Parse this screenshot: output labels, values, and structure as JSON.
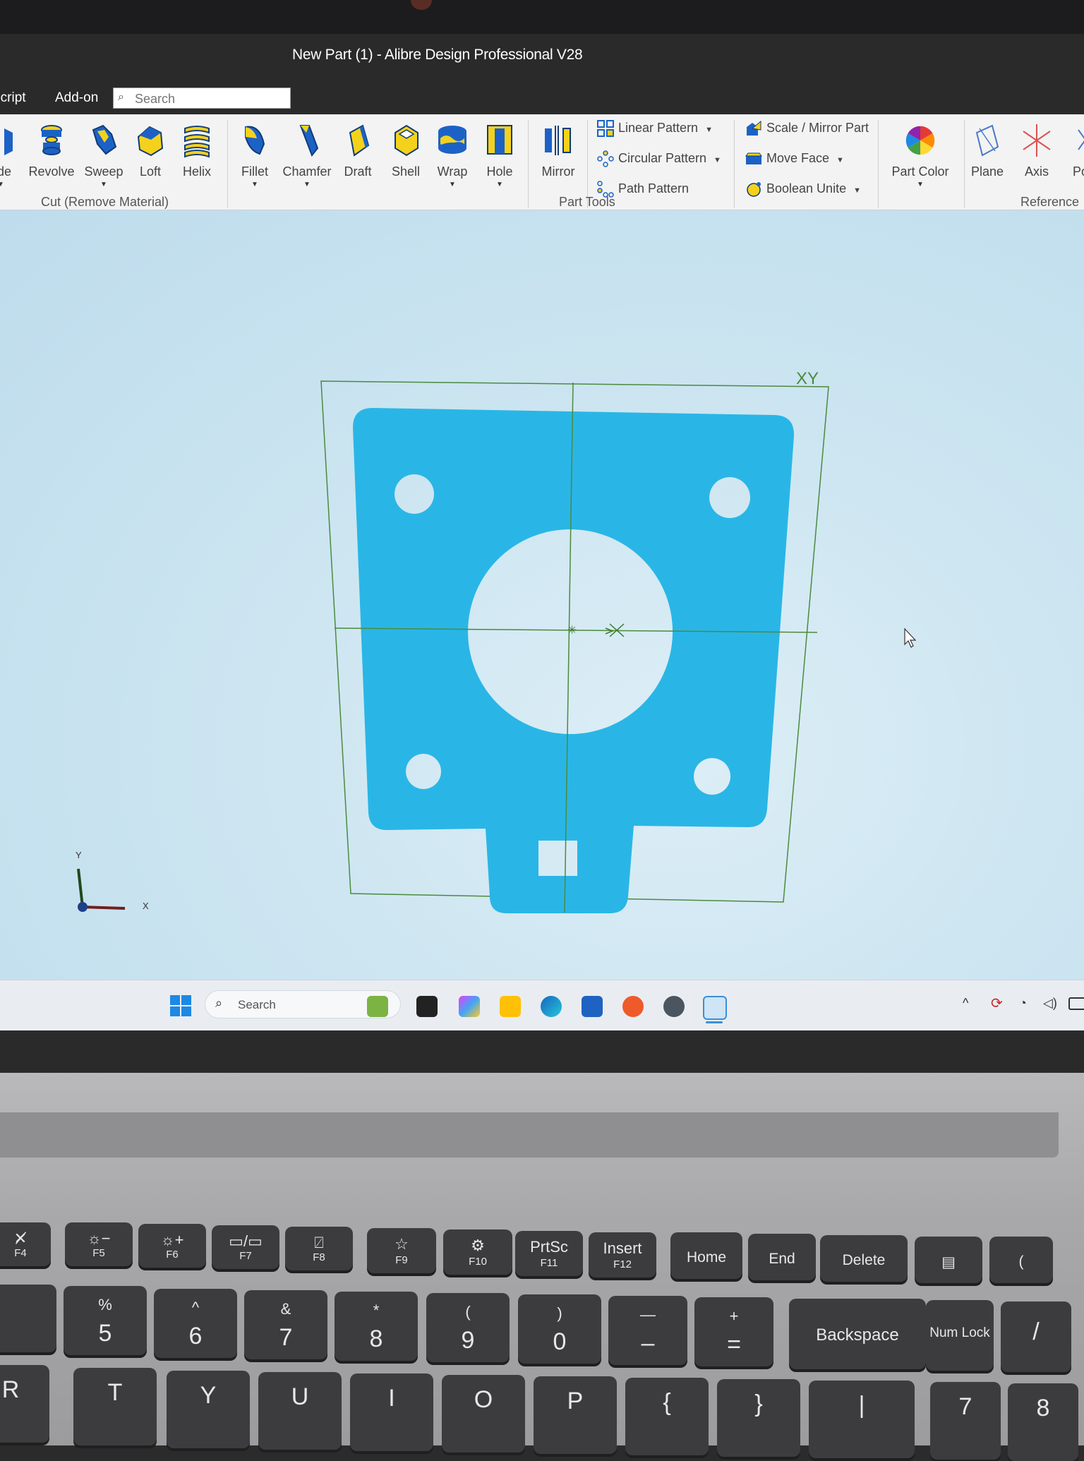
{
  "window": {
    "title": "New Part (1) - Alibre Design Professional V28"
  },
  "menu": {
    "items": [
      "Script",
      "Add-on"
    ],
    "search_placeholder": "Search"
  },
  "ribbon": {
    "cut_buttons": [
      "ude",
      "Revolve",
      "Sweep",
      "Loft",
      "Helix"
    ],
    "part_tool_buttons": [
      "Fillet",
      "Chamfer",
      "Draft",
      "Shell",
      "Wrap",
      "Hole",
      "Mirror"
    ],
    "patterns": [
      "Linear Pattern",
      "Circular Pattern",
      "Path Pattern"
    ],
    "modify": [
      "Scale / Mirror Part",
      "Move Face",
      "Boolean Unite"
    ],
    "part_color": "Part Color",
    "reference_buttons": [
      "Plane",
      "Axis",
      "Po"
    ],
    "groups": {
      "cut": "Cut (Remove Material)",
      "part_tools": "Part Tools",
      "reference": "Reference"
    }
  },
  "viewport": {
    "plane_label": "XY",
    "axis_x": "X",
    "axis_y": "Y",
    "part_color": "#29b6e6",
    "plane_color": "#4b8a3e"
  },
  "taskbar": {
    "search_text": "Search"
  },
  "keyboard": {
    "fkeys": [
      {
        "top": "✕̸",
        "bot": "F4"
      },
      {
        "top": "☼−",
        "bot": "F5"
      },
      {
        "top": "☼+",
        "bot": "F6"
      },
      {
        "top": "▭/▭",
        "bot": "F7"
      },
      {
        "top": "⍁",
        "bot": "F8"
      },
      {
        "top": "☆",
        "bot": "F9"
      },
      {
        "top": "⚙",
        "bot": "F10"
      },
      {
        "top": "PrtSc",
        "bot": "F11"
      },
      {
        "top": "Insert",
        "bot": "F12"
      },
      {
        "top": "Home",
        "bot": ""
      },
      {
        "top": "End",
        "bot": ""
      },
      {
        "top": "Delete",
        "bot": ""
      }
    ],
    "num_row": [
      {
        "top": "%",
        "big": "5"
      },
      {
        "top": "^",
        "big": "6"
      },
      {
        "top": "&",
        "big": "7"
      },
      {
        "top": "*",
        "big": "8"
      },
      {
        "top": "(",
        "big": "9"
      },
      {
        "top": ")",
        "big": "0"
      },
      {
        "top": "—",
        "big": "–"
      },
      {
        "top": "+",
        "big": "="
      }
    ],
    "backspace": "Backspace",
    "numlock": "Num Lock",
    "letters": [
      "R",
      "T",
      "Y",
      "U",
      "I",
      "O",
      "P",
      "{",
      "}",
      "|",
      "7",
      "8"
    ]
  }
}
